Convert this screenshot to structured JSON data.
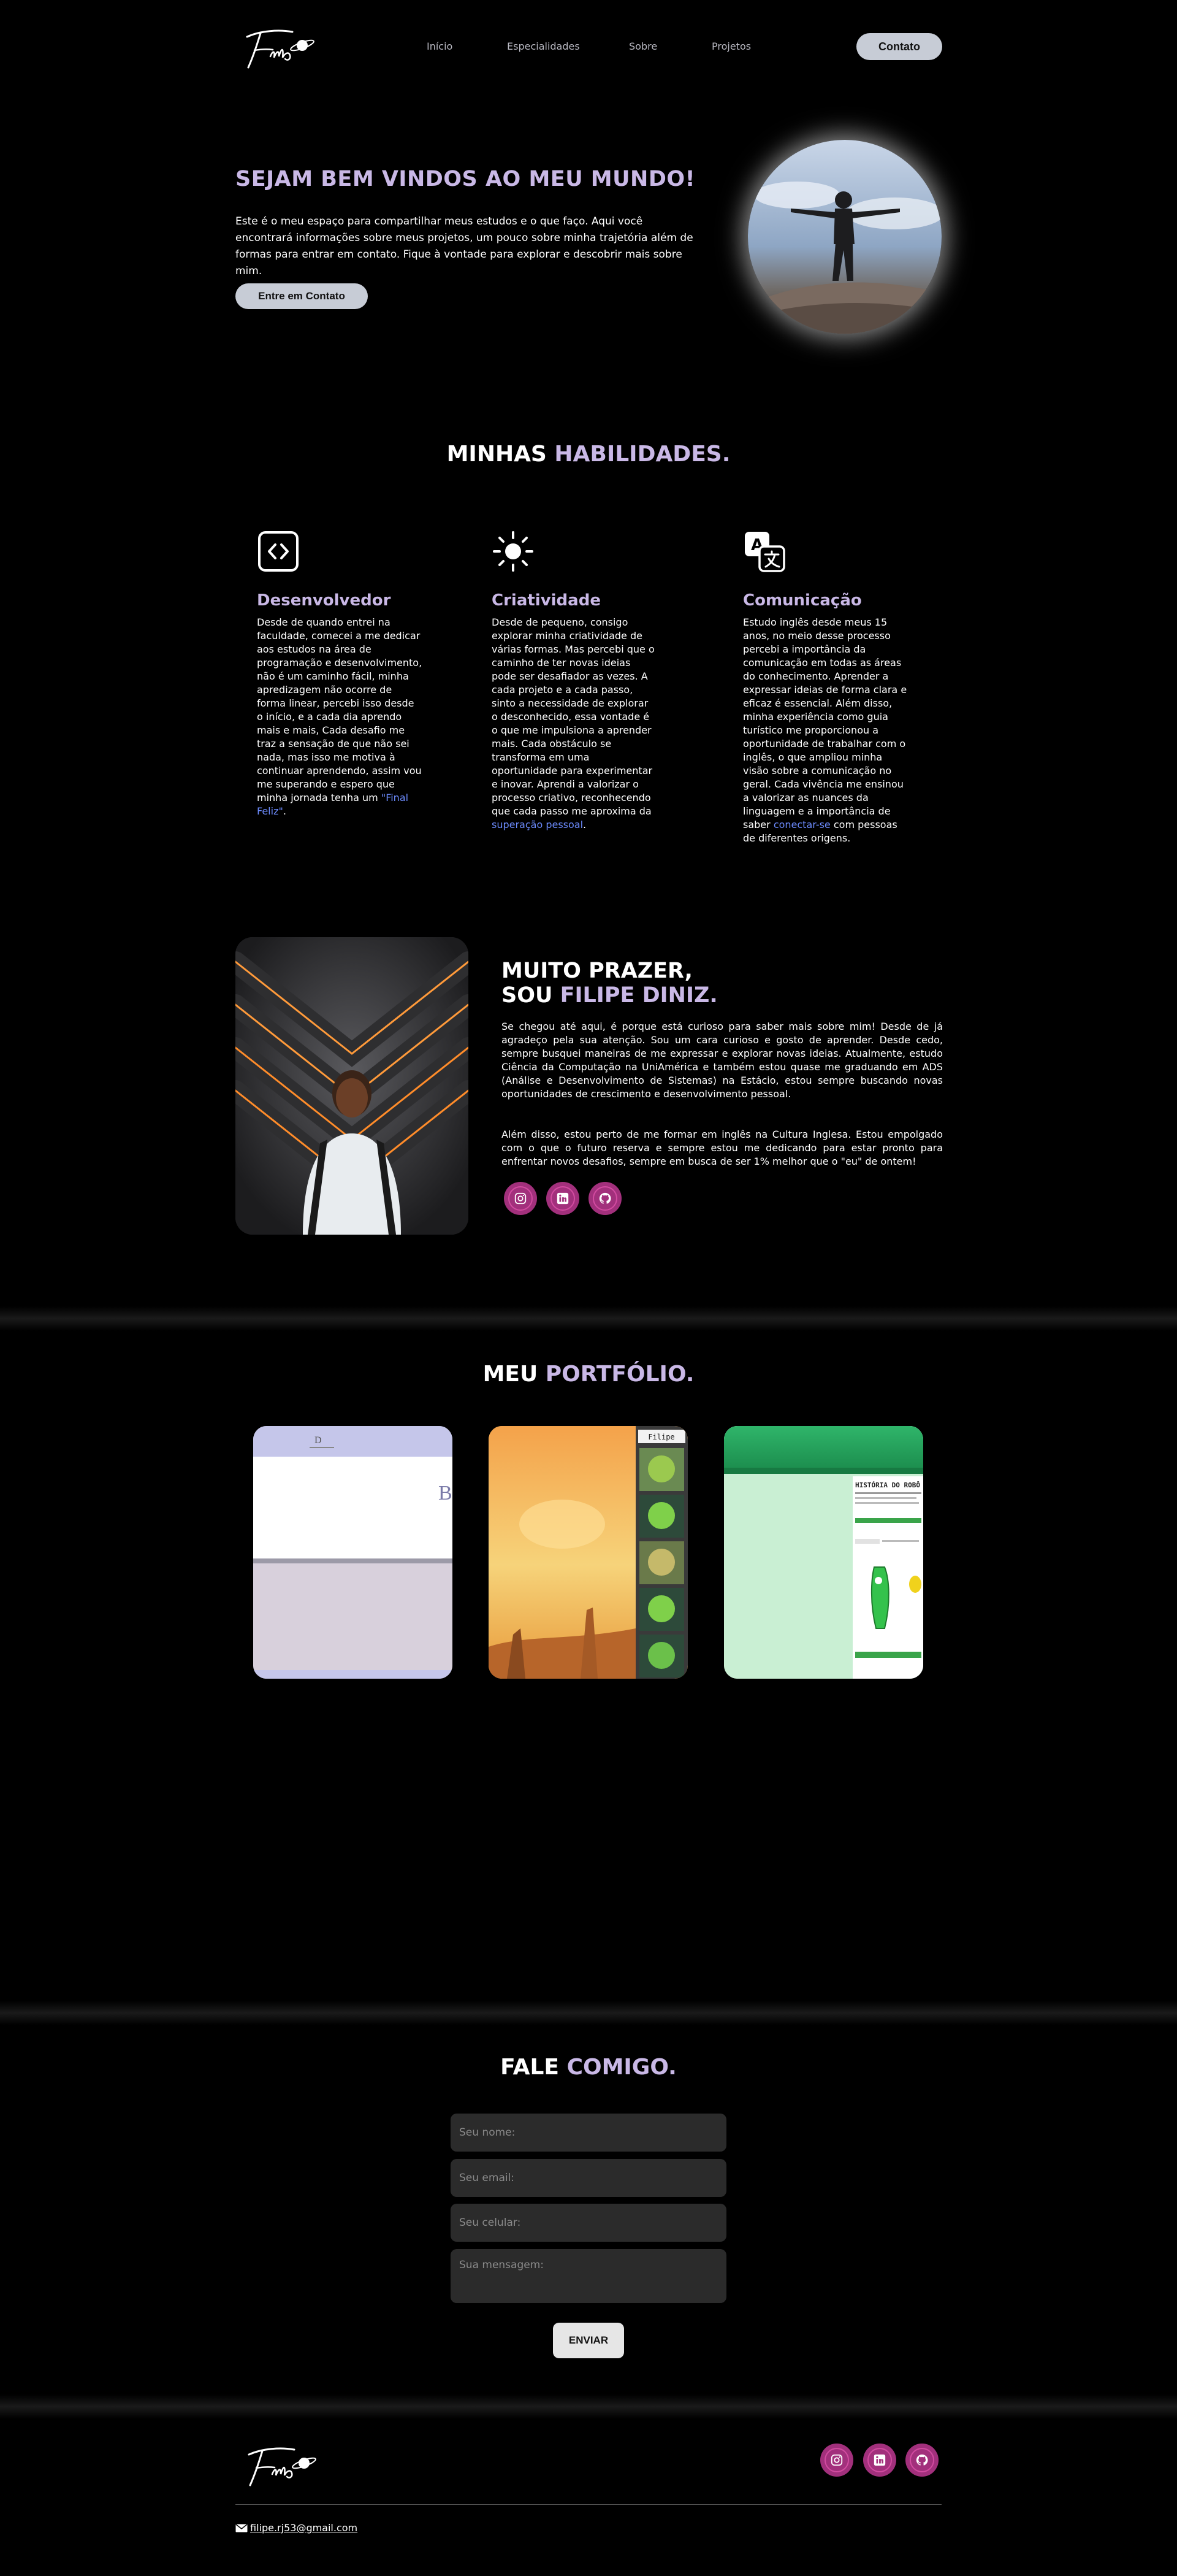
{
  "logo": {
    "text": "Filipe"
  },
  "nav": {
    "items": [
      "Início",
      "Especialidades",
      "Sobre",
      "Projetos"
    ],
    "cta": "Contato"
  },
  "hero": {
    "title": "SEJAM BEM VINDOS AO MEU MUNDO!",
    "text": "Este é o meu espaço para compartilhar meus estudos e o que faço. Aqui você encontrará informações sobre meus projetos, um pouco sobre minha trajetória além de formas para entrar em contato. Fique à vontade para explorar e descobrir mais sobre mim.",
    "button": "Entre em Contato"
  },
  "skills": {
    "title_white": "MINHAS",
    "title_purple": "HABILIDADES.",
    "items": [
      {
        "icon": "code-icon",
        "title": "Desenvolvedor",
        "text": "Desde de quando entrei na faculdade, comecei a me dedicar aos estudos na área de programação e desenvolvimento, não é um caminho fácil, minha apredizagem não ocorre de forma linear, percebi isso desde o início, e a cada dia aprendo mais e mais, Cada desafio me traz a sensação de que não sei nada, mas isso me motiva à continuar aprendendo, assim vou me superando e espero que minha jornada tenha um ",
        "highlight": "\"Final Feliz\"",
        "after": "."
      },
      {
        "icon": "sun-icon",
        "title": "Criatividade",
        "text": "Desde de pequeno, consigo explorar minha criatividade de várias formas. Mas percebi que o caminho de ter novas ideias pode ser desafiador as vezes. A cada projeto e a cada passo, sinto a necessidade de explorar o desconhecido, essa vontade é o que me impulsiona a aprender mais. Cada obstáculo se transforma em uma oportunidade para experimentar e inovar. Aprendi a valorizar o processo criativo, reconhecendo que cada passo me aproxima da ",
        "highlight": "superação pessoal",
        "after": "."
      },
      {
        "icon": "translate-icon",
        "title": "Comunicação",
        "text": "Estudo inglês desde meus 15 anos, no meio desse processo percebi a importância da comunicação em todas as áreas do conhecimento. Aprender a expressar ideias de forma clara e eficaz é essencial. Além disso, minha experiência como guia turístico me proporcionou a oportunidade de trabalhar com o inglês, o que ampliou minha visão sobre a comunicação no geral. Cada vivência me ensinou a valorizar as nuances da linguagem e a importância de saber ",
        "highlight": "conectar-se",
        "after": " com pessoas de diferentes origens."
      }
    ]
  },
  "about": {
    "title_line1": "MUITO PRAZER,",
    "title_line2_white": "SOU",
    "title_line2_purple": "FILIPE DINIZ.",
    "p1": "Se chegou até aqui, é porque está curioso para saber mais sobre mim! Desde de já agradeço pela sua atenção. Sou um cara curioso e gosto de aprender. Desde cedo, sempre busquei maneiras de me expressar e explorar novas ideias. Atualmente, estudo Ciência da Computação na UniAmérica e também estou quase me graduando em ADS (Análise e Desenvolvimento de Sistemas) na Estácio, estou sempre buscando novas oportunidades de crescimento e desenvolvimento pessoal.",
    "p2": "Além disso, estou perto de me formar em inglês na Cultura Inglesa. Estou empolgado com o que o futuro reserva e sempre estou me dedicando para estar pronto para enfrentar novos desafios, sempre em busca de ser 1% melhor que o \"eu\" de ontem!",
    "socials": [
      "instagram-icon",
      "linkedin-icon",
      "github-icon"
    ]
  },
  "portfolio": {
    "title_white": "MEU",
    "title_purple": "PORTFÓLIO.",
    "cards": [
      {
        "name": "project-card-1",
        "bg": "#d8d0dc"
      },
      {
        "name": "project-card-2",
        "bg": "#f1b85a",
        "tag": "Filipe"
      },
      {
        "name": "project-card-3",
        "bg": "#c9efd3",
        "heading": "HISTÓRIA DO ROBÔ"
      }
    ]
  },
  "contact": {
    "title_white": "FALE",
    "title_purple": "COMIGO.",
    "name_placeholder": "Seu nome:",
    "email_placeholder": "Seu email:",
    "phone_placeholder": "Seu celular:",
    "message_placeholder": "Sua mensagem:",
    "send": "ENVIAR"
  },
  "footer": {
    "email": "filipe.rj53@gmail.com",
    "socials": [
      "instagram-icon",
      "linkedin-icon",
      "github-icon"
    ]
  },
  "colors": {
    "accent_purple": "#c9b8e6",
    "link_blue": "#6d8cff",
    "social_magenta": "#a2307c",
    "button_gray": "#c7ccd6"
  }
}
